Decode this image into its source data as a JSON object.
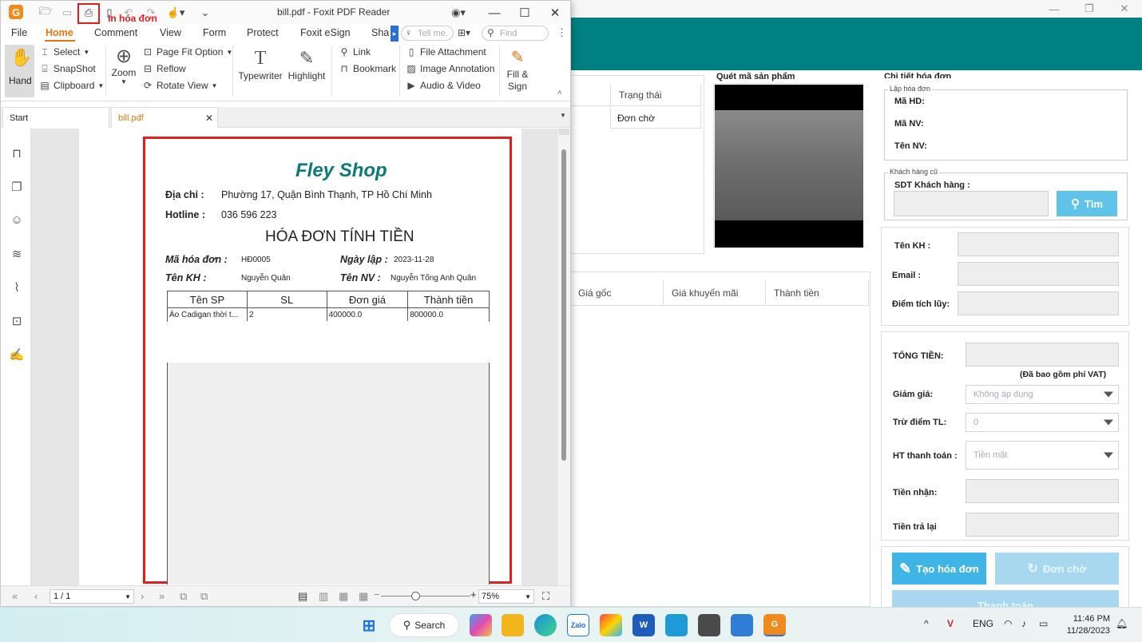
{
  "pos": {
    "grid_top_col": "Trạng thái",
    "grid_top_cell": "Đơn chờ",
    "scan_label": "Quét mã sản phẩm",
    "grid_bottom_cols": [
      "Giá gốc",
      "Giá khuyến mãi",
      "Thành tiền"
    ],
    "detail_title": "Chi tiết hóa đơn",
    "invoice_group": "Lập hóa đơn",
    "ma_hd": "Mã HD:",
    "ma_nv": "Mã NV:",
    "ten_nv": "Tên NV:",
    "customer_group": "Khách hàng cũ",
    "sdt_label": "SDT Khách hàng :",
    "find_btn": "Tìm",
    "ten_kh": "Tên KH :",
    "email": "Email :",
    "diem": "Điểm tích lũy:",
    "tong_tien": "TỔNG TIỀN:",
    "vat_note": "(Đã bao gồm phí VAT)",
    "giam_gia": "Giảm giá:",
    "giam_gia_val": "Không áp dụng",
    "tru_diem": "Trừ điểm TL:",
    "tru_diem_val": "0",
    "ht_tt": "HT thanh toán :",
    "ht_tt_val": "Tiền mặt",
    "tien_nhan": "Tiền nhận:",
    "tien_tra": "Tiền trả lại",
    "btn_create": "Tạo hóa đơn",
    "btn_wait": "Đơn chờ",
    "btn_pay": "Thanh toán"
  },
  "foxit": {
    "title": "bill.pdf - Foxit PDF Reader",
    "print_callout": "In hóa đơn",
    "menu": [
      "File",
      "Home",
      "Comment",
      "View",
      "Form",
      "Protect",
      "Foxit eSign",
      "Sha"
    ],
    "tell_me": "Tell me.",
    "find": "Find",
    "ribbon": {
      "hand": "Hand",
      "select": "Select",
      "snapshot": "SnapShot",
      "clipboard": "Clipboard",
      "zoom": "Zoom",
      "page_fit": "Page Fit Option",
      "reflow": "Reflow",
      "rotate": "Rotate View",
      "typewriter": "Typewriter",
      "highlight": "Highlight",
      "link": "Link",
      "bookmark": "Bookmark",
      "file_attachment": "File Attachment",
      "image_annotation": "Image Annotation",
      "audio_video": "Audio & Video",
      "fill_sign_1": "Fill &",
      "fill_sign_2": "Sign"
    },
    "tab_start": "Start",
    "tab_doc": "bill.pdf",
    "page_indicator": "1 / 1",
    "zoom": "75%"
  },
  "bill": {
    "shop": "Fley Shop",
    "address_label": "Địa chỉ :",
    "address": "Phường 17, Quận Bình Thạnh, TP Hồ Chí Minh",
    "hotline_label": "Hotline :",
    "hotline": "036 596 223",
    "title": "HÓA ĐƠN TÍNH TIỀN",
    "ma_hd_label": "Mã hóa đơn :",
    "ma_hd": "HĐ0005",
    "ngay_label": "Ngày lập :",
    "ngay": "2023-11-28",
    "kh_label": "Tên KH :",
    "kh": "Nguyễn Quân",
    "nv_label": "Tên NV :",
    "nv": "Nguyễn Tống Anh Quân",
    "columns": [
      "Tên SP",
      "SL",
      "Đơn giá",
      "Thành tiền"
    ],
    "row": [
      "Áo Cadigan thời t...",
      "2",
      "400000.0",
      "800000.0"
    ]
  },
  "taskbar": {
    "search": "Search",
    "lang": "ENG",
    "time": "11:46 PM",
    "date": "11/28/2023"
  }
}
